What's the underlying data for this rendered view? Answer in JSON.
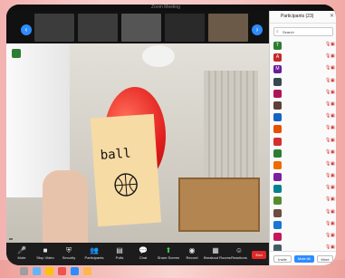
{
  "window": {
    "title": "Zoom Meeting"
  },
  "thumbnails": [
    {
      "name": ""
    },
    {
      "name": ""
    },
    {
      "name": ""
    },
    {
      "name": ""
    },
    {
      "name": ""
    }
  ],
  "main_video": {
    "note_text": "ball",
    "speaker_name": ""
  },
  "toolbar": {
    "buttons": [
      {
        "icon": "microphone-icon",
        "label": "Mute"
      },
      {
        "icon": "video-camera-icon",
        "label": "Stop Video"
      },
      {
        "icon": "shield-icon",
        "label": "Security"
      },
      {
        "icon": "participants-icon",
        "label": "Participants"
      },
      {
        "icon": "poll-icon",
        "label": "Polls"
      },
      {
        "icon": "chat-icon",
        "label": "Chat"
      },
      {
        "icon": "share-screen-icon",
        "label": "Share Screen"
      },
      {
        "icon": "record-icon",
        "label": "Record"
      },
      {
        "icon": "breakout-rooms-icon",
        "label": "Breakout Rooms"
      },
      {
        "icon": "reactions-icon",
        "label": "Reactions"
      }
    ],
    "end_label": "End"
  },
  "participants_panel": {
    "title": "Participants (23)",
    "search_placeholder": "Search",
    "participants": [
      {
        "initial": "T",
        "name": "",
        "color": "#2e7d32"
      },
      {
        "initial": "A",
        "name": "",
        "color": "#c62828"
      },
      {
        "initial": "M",
        "name": "",
        "color": "#6a1b9a"
      },
      {
        "initial": "",
        "name": "",
        "color": "#37474f"
      },
      {
        "initial": "",
        "name": "",
        "color": "#ad1457"
      },
      {
        "initial": "",
        "name": "",
        "color": "#5d4037"
      },
      {
        "initial": "",
        "name": "",
        "color": "#1565c0"
      },
      {
        "initial": "",
        "name": "",
        "color": "#e65100"
      },
      {
        "initial": "",
        "name": "",
        "color": "#d32f2f"
      },
      {
        "initial": "",
        "name": "",
        "color": "#2e7d32"
      },
      {
        "initial": "",
        "name": "",
        "color": "#ef6c00"
      },
      {
        "initial": "",
        "name": "",
        "color": "#7b1fa2"
      },
      {
        "initial": "",
        "name": "",
        "color": "#00838f"
      },
      {
        "initial": "",
        "name": "",
        "color": "#558b2f"
      },
      {
        "initial": "",
        "name": "",
        "color": "#6d4c41"
      },
      {
        "initial": "",
        "name": "",
        "color": "#1976d2"
      },
      {
        "initial": "",
        "name": "",
        "color": "#c2185b"
      },
      {
        "initial": "",
        "name": "",
        "color": "#455a64"
      }
    ],
    "footer": {
      "invite_label": "Invite",
      "mute_all_label": "Mute All",
      "more_label": "More"
    }
  },
  "colors": {
    "accent": "#2d8cff",
    "end_button": "#e02828",
    "muted_icon": "#d32f2f"
  }
}
